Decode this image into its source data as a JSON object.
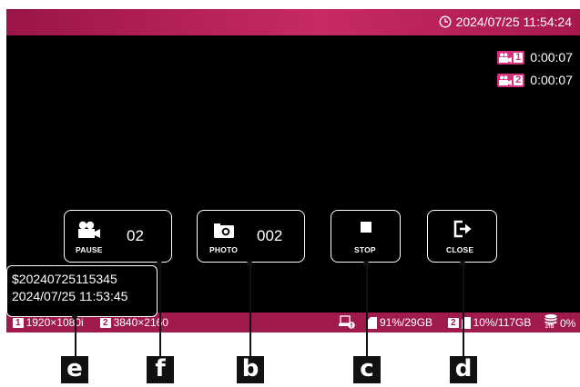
{
  "header": {
    "datetime": "2024/07/25 11:54:24"
  },
  "recorders": [
    {
      "number": "1",
      "elapsed": "0:00:07"
    },
    {
      "number": "2",
      "elapsed": "0:00:07"
    }
  ],
  "buttons": {
    "pause": {
      "label": "PAUSE",
      "count": "02"
    },
    "photo": {
      "label": "PHOTO",
      "count": "002"
    },
    "stop": {
      "label": "STOP"
    },
    "close": {
      "label": "CLOSE"
    }
  },
  "file_info": {
    "name": "$20240725115345",
    "timestamp": "2024/07/25 11:53:45"
  },
  "status": {
    "output1": {
      "number": "1",
      "resolution": "1920×1080i"
    },
    "output2": {
      "number": "2",
      "resolution": "3840×2160"
    },
    "media1": {
      "usage": "91%/29GB"
    },
    "media2": {
      "number": "2",
      "usage": "10%/117GB"
    },
    "storage": {
      "capacity_label": "2TB",
      "usage": "0%"
    }
  },
  "callouts": {
    "e": "e",
    "f": "f",
    "b": "b",
    "c": "c",
    "d": "d"
  },
  "colors": {
    "topbar": "#c82a63",
    "bottombar": "#a01a4e",
    "badge": "#d92f7f",
    "screen": "#000000"
  }
}
